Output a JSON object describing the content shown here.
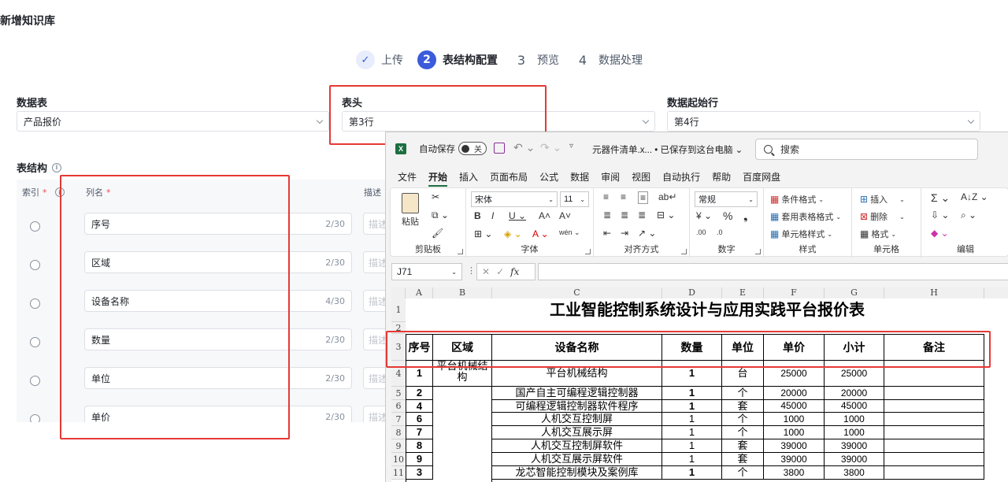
{
  "page_title": "新增知识库",
  "steps": [
    {
      "num": "✓",
      "label": "上传",
      "state": "done"
    },
    {
      "num": "2",
      "label": "表结构配置",
      "state": "active"
    },
    {
      "num": "3",
      "label": "预览",
      "state": "todo"
    },
    {
      "num": "4",
      "label": "数据处理",
      "state": "todo"
    }
  ],
  "fields": {
    "datatable": {
      "label": "数据表",
      "value": "产品报价"
    },
    "header": {
      "label": "表头",
      "value": "第3行"
    },
    "startrow": {
      "label": "数据起始行",
      "value": "第4行"
    }
  },
  "structure": {
    "title": "表结构",
    "col_index": "索引",
    "col_name": "列名",
    "col_desc": "描述",
    "desc_placeholder": "描述",
    "rows": [
      {
        "name": "序号",
        "count": "2/30"
      },
      {
        "name": "区域",
        "count": "2/30"
      },
      {
        "name": "设备名称",
        "count": "4/30"
      },
      {
        "name": "数量",
        "count": "2/30"
      },
      {
        "name": "单位",
        "count": "2/30"
      },
      {
        "name": "单价",
        "count": "2/30"
      }
    ]
  },
  "excel": {
    "autosave_label": "自动保存",
    "toggle_state": "关",
    "doc_name": "元器件清单.x... • 已保存到这台电脑",
    "search_placeholder": "搜索",
    "menu": [
      "文件",
      "开始",
      "插入",
      "页面布局",
      "公式",
      "数据",
      "审阅",
      "视图",
      "自动执行",
      "帮助",
      "百度网盘"
    ],
    "ribbon": {
      "paste": "粘贴",
      "clipboard": "剪贴板",
      "font_name": "宋体",
      "font_size": "11",
      "font_group": "字体",
      "align_group": "对齐方式",
      "number_format": "常规",
      "number_group": "数字",
      "cond_format": "条件格式",
      "table_format": "套用表格格式",
      "cell_style": "单元格样式",
      "style_group": "样式",
      "insert": "插入",
      "delete": "删除",
      "format": "格式",
      "cells_group": "单元格",
      "edit_group": "编辑"
    },
    "name_box": "J71",
    "fx": "fx",
    "col_headers": [
      "A",
      "B",
      "C",
      "D",
      "E",
      "F",
      "G",
      "H"
    ],
    "row_numbers": [
      "1",
      "2",
      "3",
      "4",
      "5",
      "6",
      "7",
      "8",
      "9",
      "10",
      "11"
    ],
    "sheet_title": "工业智能控制系统设计与应用实践平台报价表",
    "table_headers": [
      "序号",
      "区域",
      "设备名称",
      "数量",
      "单位",
      "单价",
      "小计",
      "备注"
    ],
    "region_first": "平台机械结构",
    "rows": [
      {
        "no": "1",
        "name": "平台机械结构",
        "qty": "1",
        "unit": "台",
        "price": "25000",
        "subtotal": "25000"
      },
      {
        "no": "2",
        "name": "国产自主可编程逻辑控制器",
        "qty": "1",
        "unit": "个",
        "price": "20000",
        "subtotal": "20000"
      },
      {
        "no": "4",
        "name": "可编程逻辑控制器软件程序",
        "qty": "1",
        "unit": "套",
        "price": "45000",
        "subtotal": "45000"
      },
      {
        "no": "6",
        "name": "人机交互控制屏",
        "qty": "1",
        "unit": "个",
        "price": "1000",
        "subtotal": "1000"
      },
      {
        "no": "7",
        "name": "人机交互展示屏",
        "qty": "1",
        "unit": "个",
        "price": "1000",
        "subtotal": "1000"
      },
      {
        "no": "8",
        "name": "人机交互控制屏软件",
        "qty": "1",
        "unit": "套",
        "price": "39000",
        "subtotal": "39000"
      },
      {
        "no": "9",
        "name": "人机交互展示屏软件",
        "qty": "1",
        "unit": "套",
        "price": "39000",
        "subtotal": "39000"
      },
      {
        "no": "3",
        "name": "龙芯智能控制模块及案例库",
        "qty": "1",
        "unit": "个",
        "price": "3800",
        "subtotal": "3800"
      }
    ]
  }
}
